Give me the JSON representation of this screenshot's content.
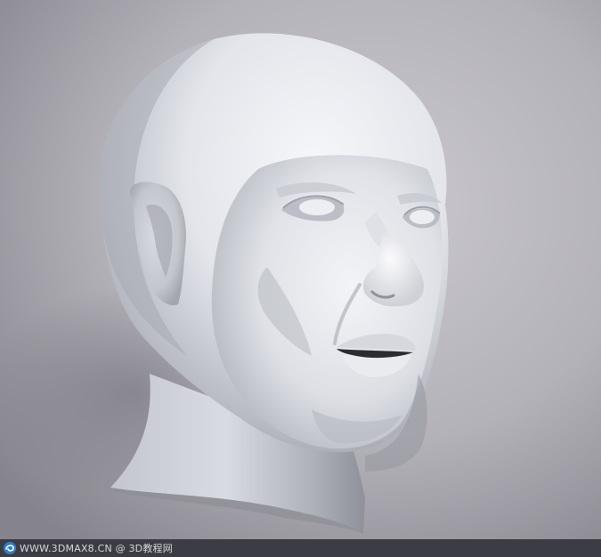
{
  "scene": {
    "subject_icon": "head-bust-icon",
    "colors": {
      "background_light": "#c8c6cc",
      "background_dark": "#87868e",
      "skin_light": "#f1f2f6",
      "skin_mid": "#c9cbd3",
      "skin_shadow": "#8d8f98",
      "lip_dark": "#2b2b31"
    }
  },
  "watermark": {
    "logo_icon": "swirl-logo-icon",
    "text": "WWW.3DMAX8.CN @ 3D教程网",
    "bar_color": "#3c3d44",
    "text_color": "#d6d6dc"
  }
}
